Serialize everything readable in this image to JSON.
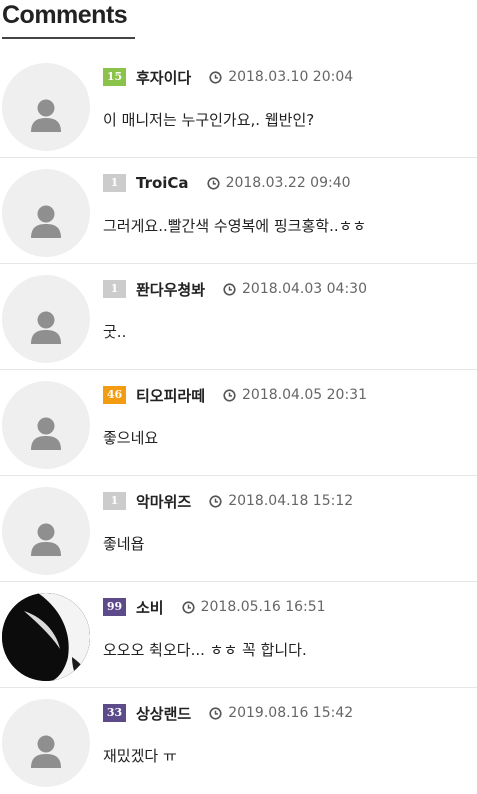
{
  "section": {
    "title": "Comments"
  },
  "comments": [
    {
      "level": "15",
      "level_color": "#8bc34a",
      "author": "후자이다",
      "date": "2018.03.10 20:04",
      "text": "이 매니저는 누구인가요,. 웹반인?",
      "avatar": "default"
    },
    {
      "level": "1",
      "level_color": "#cccccc",
      "author": "TroiCa",
      "date": "2018.03.22 09:40",
      "text": "그러게요..빨간색 수영복에 핑크홍학..ㅎㅎ",
      "avatar": "default"
    },
    {
      "level": "1",
      "level_color": "#cccccc",
      "author": "퐌다우쳥봐",
      "date": "2018.04.03 04:30",
      "text": "굿..",
      "avatar": "default"
    },
    {
      "level": "46",
      "level_color": "#f39c12",
      "author": "티오피라떼",
      "date": "2018.04.05 20:31",
      "text": "좋으네요",
      "avatar": "default"
    },
    {
      "level": "1",
      "level_color": "#cccccc",
      "author": "악마위즈",
      "date": "2018.04.18 15:12",
      "text": "좋네욥",
      "avatar": "default"
    },
    {
      "level": "99",
      "level_color": "#5c4a8a",
      "author": "소비",
      "date": "2018.05.16 16:51",
      "text": "오오오 췩오다... ㅎㅎ 꼭 합니다.",
      "avatar": "photo"
    },
    {
      "level": "33",
      "level_color": "#5c4a8a",
      "author": "상상랜드",
      "date": "2019.08.16 15:42",
      "text": "재밌겠다 ㅠ",
      "avatar": "default"
    }
  ]
}
